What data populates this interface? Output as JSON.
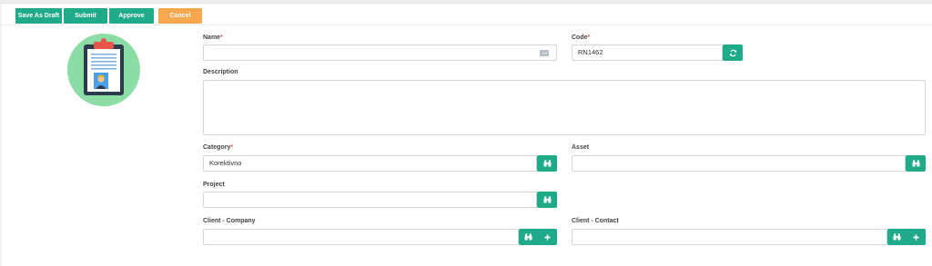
{
  "toolbar": {
    "save_draft": "Save As Draft",
    "submit": "Submit",
    "approve": "Approve",
    "cancel": "Cancel"
  },
  "colors": {
    "accent": "#1fab89",
    "cancel": "#f7a84e",
    "avatar_bg": "#8cdca5",
    "required": "#e05a5a"
  },
  "form": {
    "name": {
      "label": "Name",
      "value": "",
      "icon": "keyboard-icon"
    },
    "code": {
      "label": "Code",
      "value": "RN1462",
      "button_icon": "refresh-icon"
    },
    "description": {
      "label": "Description",
      "value": ""
    },
    "category": {
      "label": "Category",
      "value": "Korektivno",
      "button_icon": "binoculars-icon"
    },
    "asset": {
      "label": "Asset",
      "value": "",
      "button_icon": "binoculars-icon"
    },
    "project": {
      "label": "Project",
      "value": "",
      "button_icon": "binoculars-icon"
    },
    "client_company": {
      "label": "Client - Company",
      "value": "",
      "button_icons": [
        "binoculars-icon",
        "plus-icon"
      ]
    },
    "client_contact": {
      "label": "Client - Contact",
      "value": "",
      "button_icons": [
        "binoculars-icon",
        "plus-icon"
      ]
    },
    "required_mark": "*"
  }
}
